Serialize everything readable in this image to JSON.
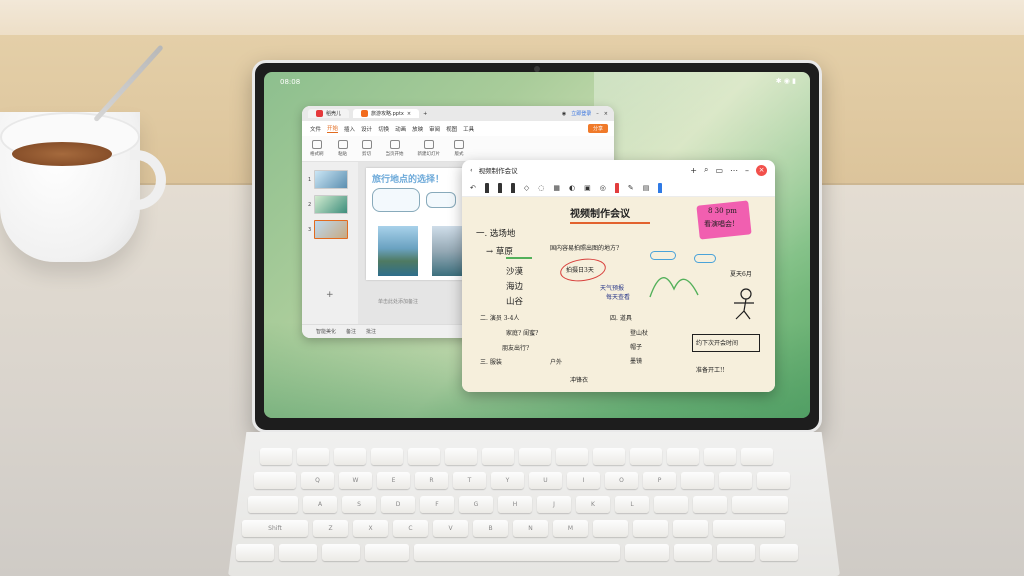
{
  "statusbar": {
    "time": "08:08",
    "icons": "✱ ◉ ▮"
  },
  "ppt": {
    "tabs": [
      {
        "label": "稻壳儿"
      },
      {
        "label": "旅游攻略.pptx"
      }
    ],
    "login": "立即登录",
    "menu": [
      "文件",
      "开始",
      "插入",
      "设计",
      "切换",
      "动画",
      "放映",
      "审阅",
      "视图",
      "工具"
    ],
    "active_menu": "开始",
    "share": "分享",
    "toolbar": [
      "格式刷",
      "粘贴",
      "剪切",
      "当页开始",
      "新建幻灯片",
      "版式"
    ],
    "slide_numbers": [
      "1",
      "2",
      "3"
    ],
    "slide_title": "旅行地点的选择！",
    "notes_placeholder": "单击此处添加备注",
    "statusbar": [
      "智能美化",
      "备注",
      "批注"
    ]
  },
  "notes_app": {
    "title": "视频制作会议",
    "canvas": {
      "heading": "视频制作会议",
      "sticky": [
        "8 30 pm",
        "看演唱会!"
      ],
      "item1": "一. 选场地",
      "arrow_label": "→ 草原",
      "question": "国内容易拍照出图的地方?",
      "options": [
        "沙漠",
        "海边",
        "山谷"
      ],
      "circled": "拍摄日3天",
      "weather": [
        "天气预报",
        "每天查看"
      ],
      "summer": "夏天6月",
      "item2": "二. 演员  3-4人",
      "item2_q": "家庭?  闺蜜?",
      "item2_q2": "朋友出行?",
      "item3": "三. 服装",
      "outdoor": "户外",
      "jacket": "冲锋衣",
      "props_title": "四. 道具",
      "props": [
        "登山杖",
        "帽子",
        "墨镜"
      ],
      "meeting": "约下次开会时间",
      "ready": "准备开工!!"
    }
  },
  "keyboard": {
    "rows": [
      [
        "",
        "",
        "",
        "",
        "",
        "",
        "",
        "",
        "",
        "",
        "",
        "",
        "",
        ""
      ],
      [
        "",
        "Q",
        "W",
        "E",
        "R",
        "T",
        "Y",
        "U",
        "I",
        "O",
        "P",
        "",
        "",
        ""
      ],
      [
        "",
        "A",
        "S",
        "D",
        "F",
        "G",
        "H",
        "J",
        "K",
        "L",
        "",
        "",
        ""
      ],
      [
        "Shift",
        "Z",
        "X",
        "C",
        "V",
        "B",
        "N",
        "M",
        "",
        "",
        "",
        ""
      ],
      [
        "",
        "",
        "",
        "",
        "",
        "",
        "",
        "",
        ""
      ]
    ]
  }
}
